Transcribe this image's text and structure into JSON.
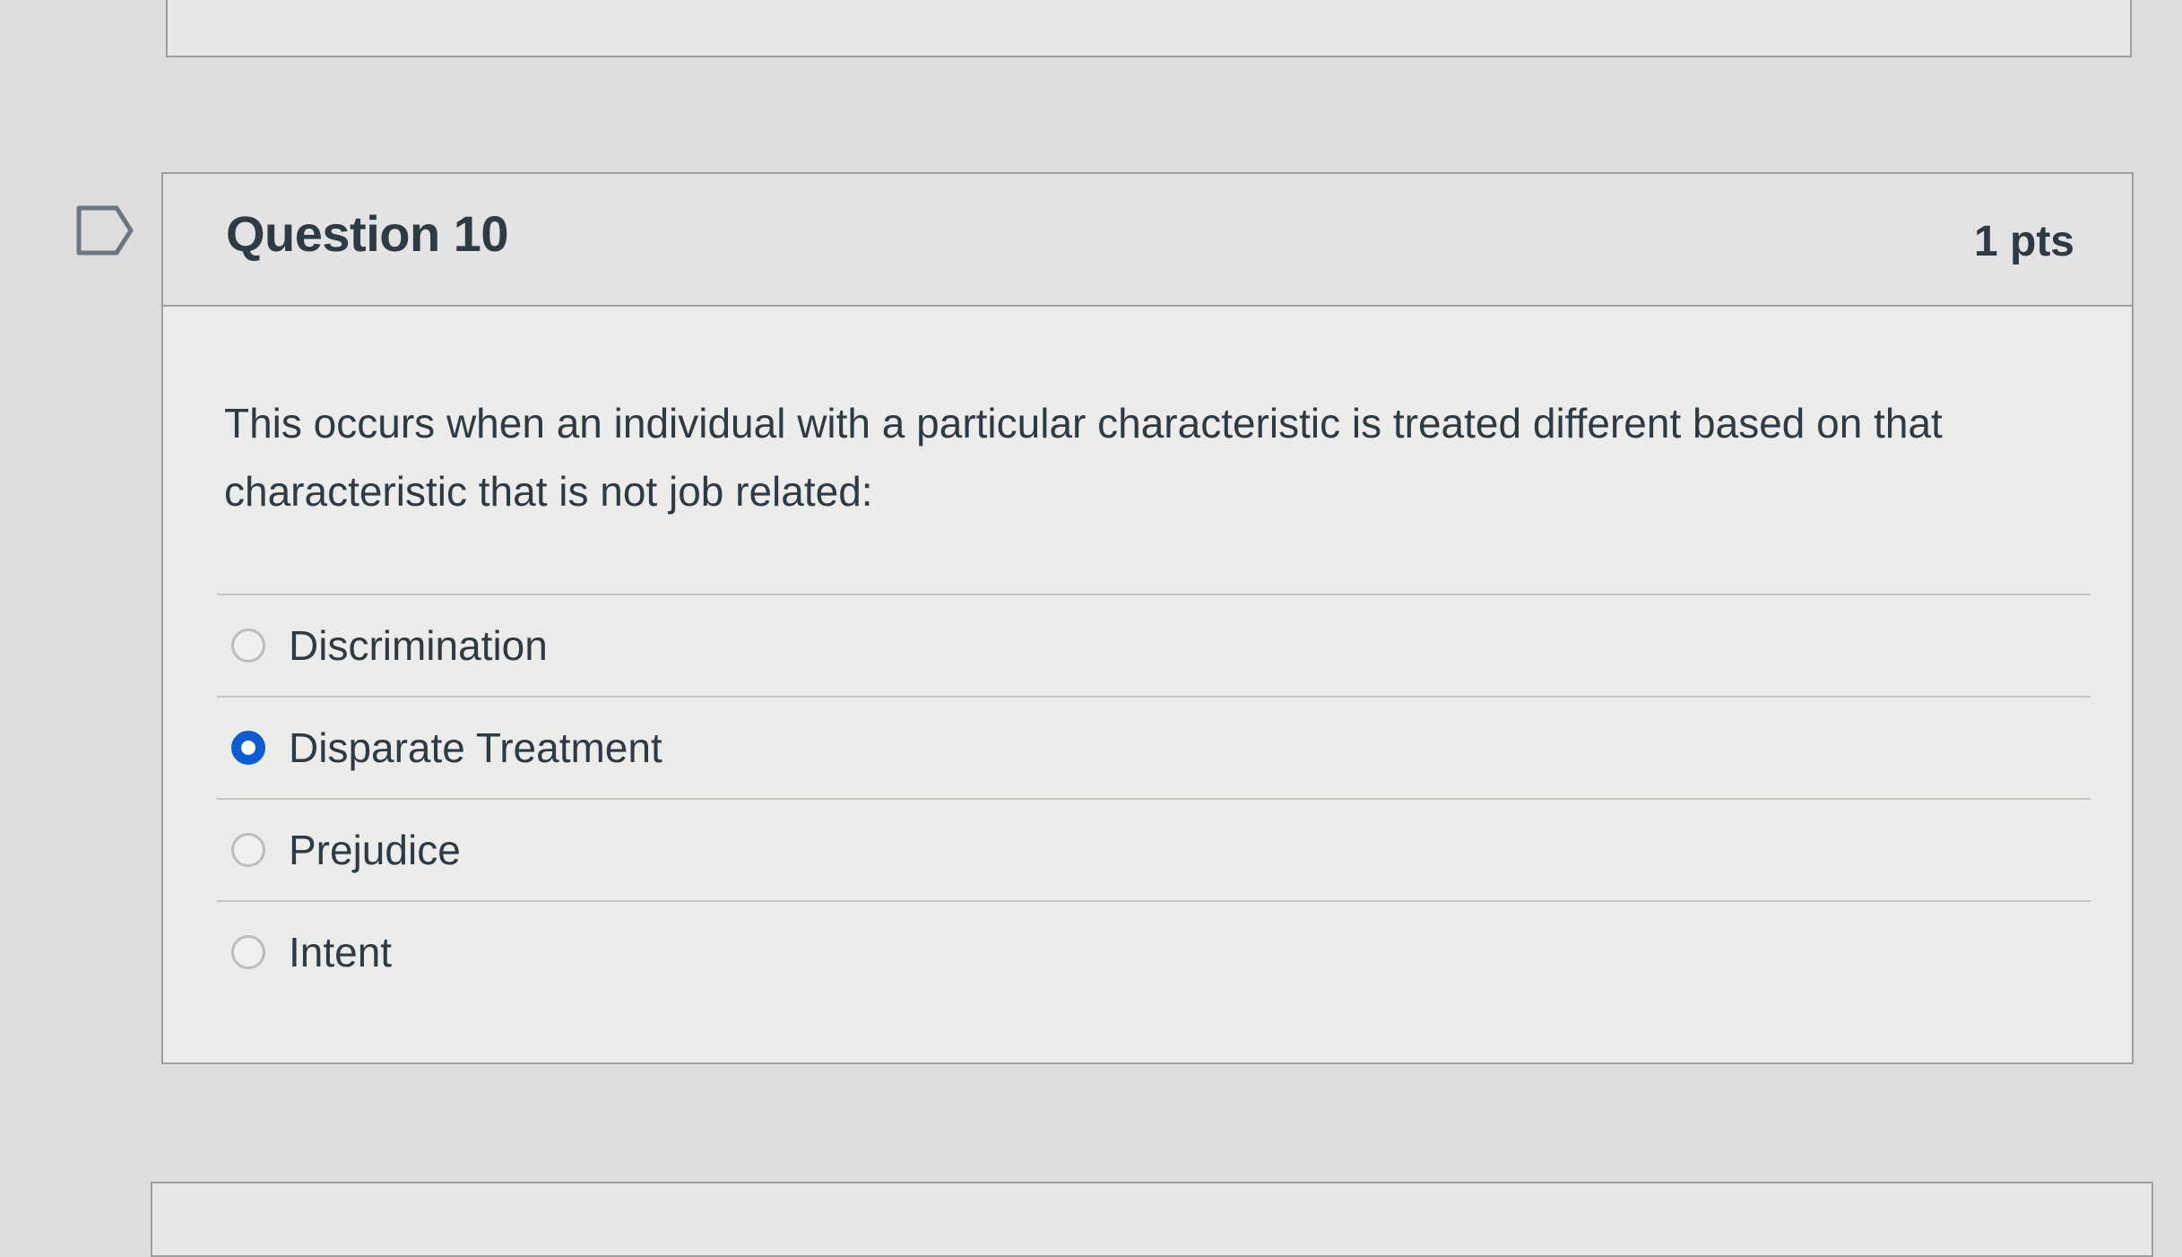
{
  "question": {
    "title": "Question 10",
    "points": "1 pts",
    "text": "This occurs when an individual with a particular characteristic is treated different based on that characteristic that is not job related:",
    "flag_icon": "flag-outline-icon"
  },
  "answers": [
    {
      "label": "Discrimination",
      "selected": false
    },
    {
      "label": "Disparate Treatment",
      "selected": true
    },
    {
      "label": "Prejudice",
      "selected": false
    },
    {
      "label": "Intent",
      "selected": false
    }
  ],
  "colors": {
    "accent": "#0b5cd5",
    "text": "#2d3b45",
    "border": "#9aa0a3"
  }
}
